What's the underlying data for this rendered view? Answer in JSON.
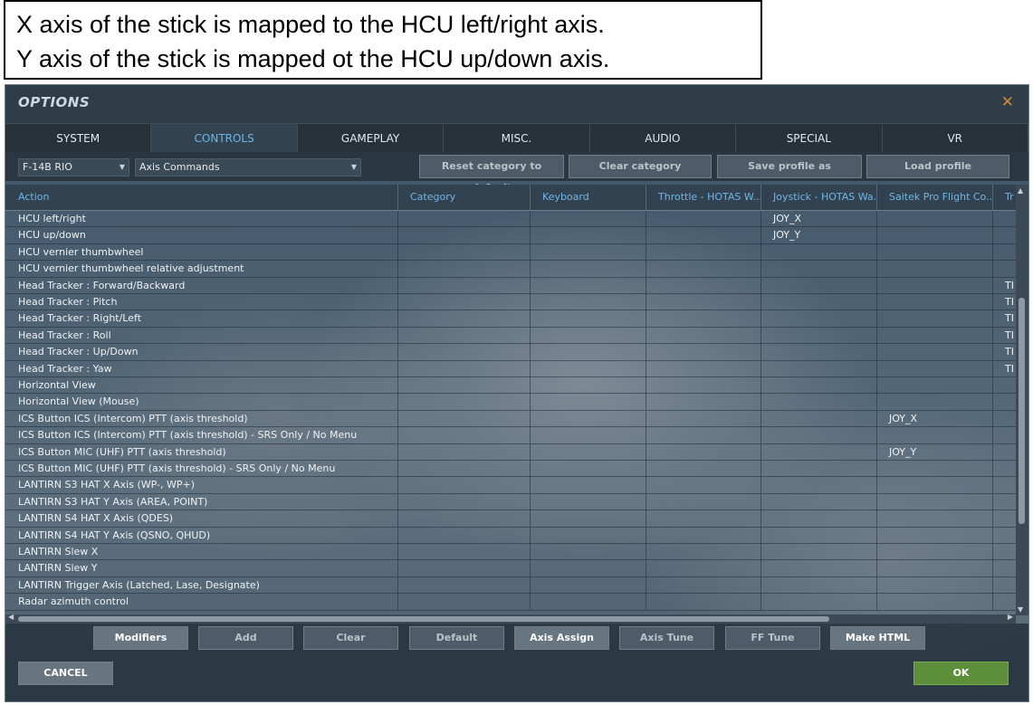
{
  "annotation": {
    "line1": "X axis of the stick is mapped to the HCU left/right axis.",
    "line2": "Y axis of the stick is mapped ot the HCU up/down axis."
  },
  "window": {
    "title": "OPTIONS",
    "close_icon": "close-icon"
  },
  "tabs": [
    "SYSTEM",
    "CONTROLS",
    "GAMEPLAY",
    "MISC.",
    "AUDIO",
    "SPECIAL",
    "VR"
  ],
  "active_tab": "CONTROLS",
  "filters": {
    "aircraft": "F-14B RIO",
    "category": "Axis Commands"
  },
  "toolbar": {
    "reset_category": "Reset category to default",
    "clear_category": "Clear category",
    "save_profile": "Save profile as",
    "load_profile": "Load profile"
  },
  "table": {
    "columns": [
      "Action",
      "Category",
      "Keyboard",
      "Throttle - HOTAS W...",
      "Joystick - HOTAS Wa...",
      "Saitek Pro Flight Co...",
      "Tr"
    ],
    "rows": [
      [
        "HCU left/right",
        "",
        "",
        "",
        "JOY_X",
        "",
        ""
      ],
      [
        "HCU up/down",
        "",
        "",
        "",
        "JOY_Y",
        "",
        ""
      ],
      [
        "HCU vernier thumbwheel",
        "",
        "",
        "",
        "",
        "",
        ""
      ],
      [
        "HCU vernier thumbwheel relative adjustment",
        "",
        "",
        "",
        "",
        "",
        ""
      ],
      [
        "Head Tracker : Forward/Backward",
        "",
        "",
        "",
        "",
        "",
        "TI"
      ],
      [
        "Head Tracker : Pitch",
        "",
        "",
        "",
        "",
        "",
        "TI"
      ],
      [
        "Head Tracker : Right/Left",
        "",
        "",
        "",
        "",
        "",
        "TI"
      ],
      [
        "Head Tracker : Roll",
        "",
        "",
        "",
        "",
        "",
        "TI"
      ],
      [
        "Head Tracker : Up/Down",
        "",
        "",
        "",
        "",
        "",
        "TI"
      ],
      [
        "Head Tracker : Yaw",
        "",
        "",
        "",
        "",
        "",
        "TI"
      ],
      [
        "Horizontal View",
        "",
        "",
        "",
        "",
        "",
        ""
      ],
      [
        "Horizontal View (Mouse)",
        "",
        "",
        "",
        "",
        "",
        ""
      ],
      [
        "ICS Button ICS (Intercom) PTT (axis threshold)",
        "",
        "",
        "",
        "",
        "JOY_X",
        ""
      ],
      [
        "ICS Button ICS (Intercom) PTT (axis threshold) - SRS Only / No Menu",
        "",
        "",
        "",
        "",
        "",
        ""
      ],
      [
        "ICS Button MIC (UHF) PTT (axis threshold)",
        "",
        "",
        "",
        "",
        "JOY_Y",
        ""
      ],
      [
        "ICS Button MIC (UHF) PTT (axis threshold) - SRS Only / No Menu",
        "",
        "",
        "",
        "",
        "",
        ""
      ],
      [
        "LANTIRN S3 HAT X Axis (WP-, WP+)",
        "",
        "",
        "",
        "",
        "",
        ""
      ],
      [
        "LANTIRN S3 HAT Y Axis (AREA, POINT)",
        "",
        "",
        "",
        "",
        "",
        ""
      ],
      [
        "LANTIRN S4 HAT X Axis (QDES)",
        "",
        "",
        "",
        "",
        "",
        ""
      ],
      [
        "LANTIRN S4 HAT Y Axis (QSNO, QHUD)",
        "",
        "",
        "",
        "",
        "",
        ""
      ],
      [
        "LANTIRN Slew X",
        "",
        "",
        "",
        "",
        "",
        ""
      ],
      [
        "LANTIRN Slew Y",
        "",
        "",
        "",
        "",
        "",
        ""
      ],
      [
        "LANTIRN Trigger Axis (Latched, Lase, Designate)",
        "",
        "",
        "",
        "",
        "",
        ""
      ],
      [
        "Radar azimuth control",
        "",
        "",
        "",
        "",
        "",
        ""
      ]
    ]
  },
  "bottom_buttons": {
    "modifiers": "Modifiers",
    "add": "Add",
    "clear": "Clear",
    "default": "Default",
    "axis_assign": "Axis Assign",
    "axis_tune": "Axis Tune",
    "ff_tune": "FF Tune",
    "make_html": "Make HTML"
  },
  "footer": {
    "cancel": "CANCEL",
    "ok": "OK"
  }
}
